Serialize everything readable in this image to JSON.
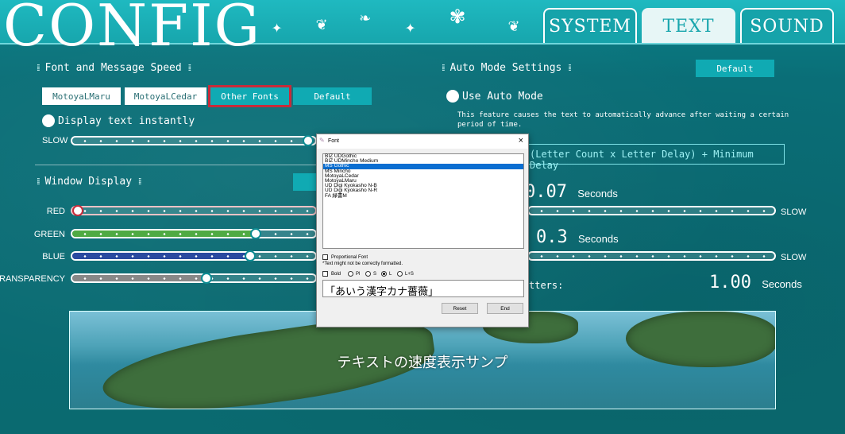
{
  "header": {
    "title": "CONFIG",
    "tabs": [
      {
        "label": "SYSTEM"
      },
      {
        "label": "TEXT"
      },
      {
        "label": "SOUND"
      }
    ]
  },
  "font_section": {
    "title": "Font and Message Speed",
    "buttons": {
      "motoya_maru": "MotoyaLMaru",
      "motoya_cedar": "MotoyaLCedar",
      "other_fonts": "Other Fonts",
      "default": "Default"
    },
    "display_instant": "Display text instantly",
    "speed_slow": "SLOW"
  },
  "window_section": {
    "title": "Window Display",
    "sliders": [
      {
        "label": "RED",
        "level": 0.0,
        "color": "#d8434f"
      },
      {
        "label": "GREEN",
        "level": 0.75,
        "color": "#4faa43"
      },
      {
        "label": "BLUE",
        "level": 0.73,
        "color": "#2a4aa0"
      },
      {
        "label": "TRANSPARENCY",
        "level": 0.55,
        "color": "#888888"
      }
    ]
  },
  "auto_section": {
    "title": "Auto Mode Settings",
    "default_button": "Default",
    "use_auto": "Use Auto Mode",
    "description": "This feature causes the text to automatically advance after waiting a certain period of time.",
    "formula": "(Letter Count x Letter Delay) + Minimum Delay",
    "values": [
      {
        "number": "0.07",
        "unit": "Seconds"
      },
      {
        "number": "0.3",
        "unit": "Seconds"
      }
    ],
    "letters_label": "tters:",
    "letters_value": {
      "number": "1.00",
      "unit": "Seconds"
    },
    "slider_right_label": "SLOW"
  },
  "font_dialog": {
    "title": "Font",
    "fonts": [
      "BIZ UDGothic",
      "BIZ UDMincho Medium",
      "MS Gothic",
      "MS Mincho",
      "MotoyaLCedar",
      "MotoyaLMaru",
      "UD Digi Kyokasho N-B",
      "UD Digi Kyokasho N-R",
      "FA 緑書M"
    ],
    "selected": "MS Gothic",
    "proportional": "Proportional Font",
    "note": "*Text might not be correctly formatted.",
    "bold": "Bold",
    "size_options": [
      "Pl",
      "S",
      "L",
      "L+S"
    ],
    "size_selected": "L",
    "preview": "「あいう漢字カナ薔薇」",
    "reset": "Reset",
    "end": "End"
  },
  "sample": {
    "text": "テキストの速度表示サンプ"
  }
}
